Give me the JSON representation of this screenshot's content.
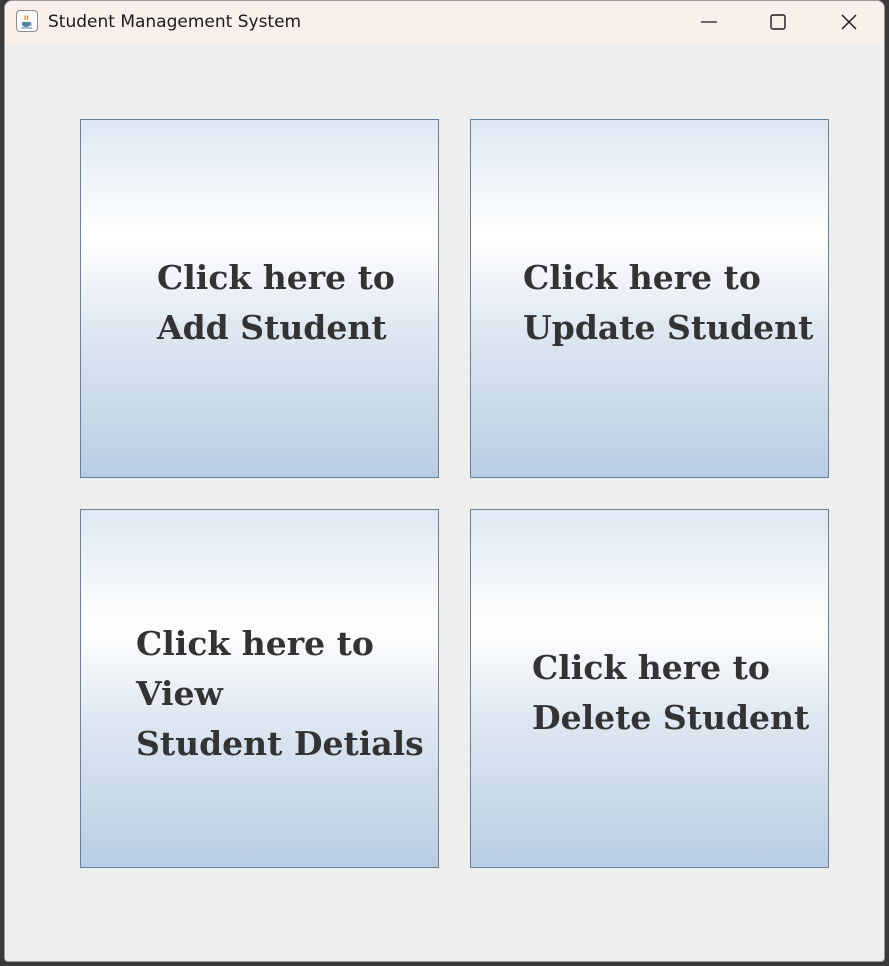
{
  "window": {
    "title": "Student Management System",
    "icon": "java-cup-icon"
  },
  "controls": {
    "minimize": "minimize-icon",
    "maximize": "maximize-icon",
    "close": "close-icon"
  },
  "tiles": [
    {
      "lines": [
        "Click here to",
        "Add Student"
      ]
    },
    {
      "lines": [
        "Click here to",
        "Update Student"
      ]
    },
    {
      "lines": [
        "Click here to",
        "View",
        "Student Detials"
      ]
    },
    {
      "lines": [
        "Click here to",
        "Delete Student"
      ]
    }
  ],
  "colors": {
    "tile_border": "#6b7f96",
    "tile_gradient_top": "#dde8f3",
    "tile_gradient_bottom": "#b8cde3",
    "tile_text": "#333333",
    "titlebar_bg": "#faf0eb",
    "client_bg": "#eeeeee"
  }
}
